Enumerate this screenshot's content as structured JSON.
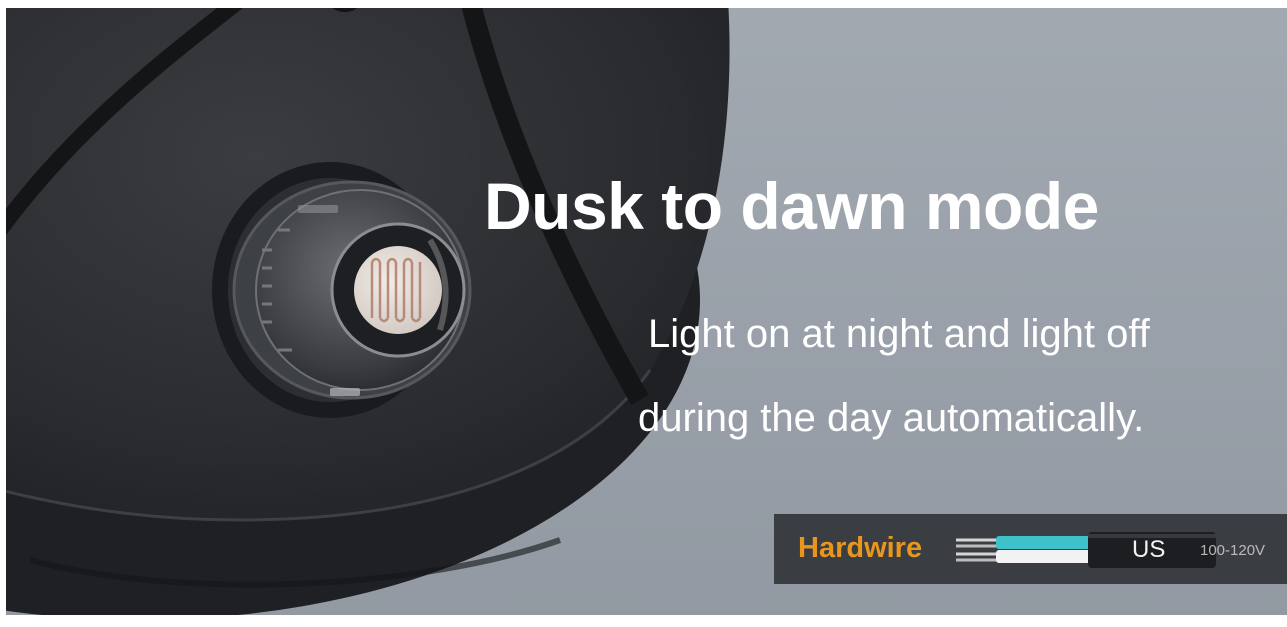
{
  "headline": "Dusk to dawn mode",
  "description": {
    "line1": "Light on at night and light off",
    "line2": "during the day automatically."
  },
  "badge": {
    "label": "Hardwire",
    "region": "US",
    "voltage": "100-120V"
  },
  "colors": {
    "background": "#9aa2ab",
    "fixture": "#26282b",
    "badge_background": "#3a3d42",
    "badge_label": "#e8961c",
    "text": "#ffffff"
  },
  "icons": {
    "fixture": "light-fixture-photo",
    "sensor": "photocell-sensor",
    "wire": "hardwire-cable"
  }
}
